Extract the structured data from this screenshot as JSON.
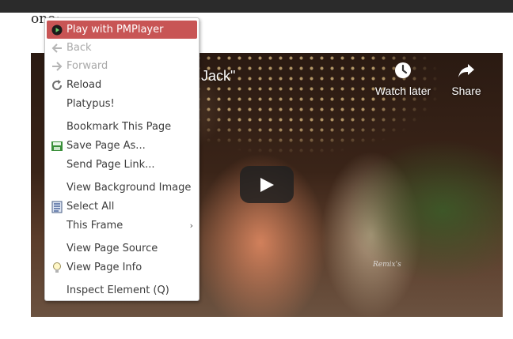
{
  "page": {
    "partial_text": "one:"
  },
  "video": {
    "title_fragment": "e Jack\"",
    "watch_later_label": "Watch later",
    "share_label": "Share",
    "watermark": "Remix's"
  },
  "context_menu": {
    "items": [
      {
        "label": "Play with PMPlayer",
        "icon": "pmplayer-icon",
        "state": "highlighted"
      },
      {
        "label": "Back",
        "icon": "back-arrow-icon",
        "state": "disabled"
      },
      {
        "label": "Forward",
        "icon": "forward-arrow-icon",
        "state": "disabled"
      },
      {
        "label": "Reload",
        "icon": "reload-icon",
        "state": "enabled"
      },
      {
        "label": "Platypus!",
        "icon": "",
        "state": "enabled"
      },
      {
        "label": "Bookmark This Page",
        "icon": "",
        "state": "enabled"
      },
      {
        "label": "Save Page As...",
        "icon": "save-page-icon",
        "state": "enabled"
      },
      {
        "label": "Send Page Link...",
        "icon": "",
        "state": "enabled"
      },
      {
        "label": "View Background Image",
        "icon": "",
        "state": "enabled"
      },
      {
        "label": "Select All",
        "icon": "select-all-icon",
        "state": "enabled"
      },
      {
        "label": "This Frame",
        "icon": "",
        "state": "enabled",
        "submenu": true
      },
      {
        "label": "View Page Source",
        "icon": "",
        "state": "enabled"
      },
      {
        "label": "View Page Info",
        "icon": "lightbulb-icon",
        "state": "enabled"
      },
      {
        "label": "Inspect Element (Q)",
        "icon": "",
        "state": "enabled"
      }
    ]
  },
  "colors": {
    "highlight": "#c85555",
    "menu_text": "#3c3c3c",
    "disabled_text": "#a9a9a9",
    "top_bar": "#2b2b2b"
  }
}
